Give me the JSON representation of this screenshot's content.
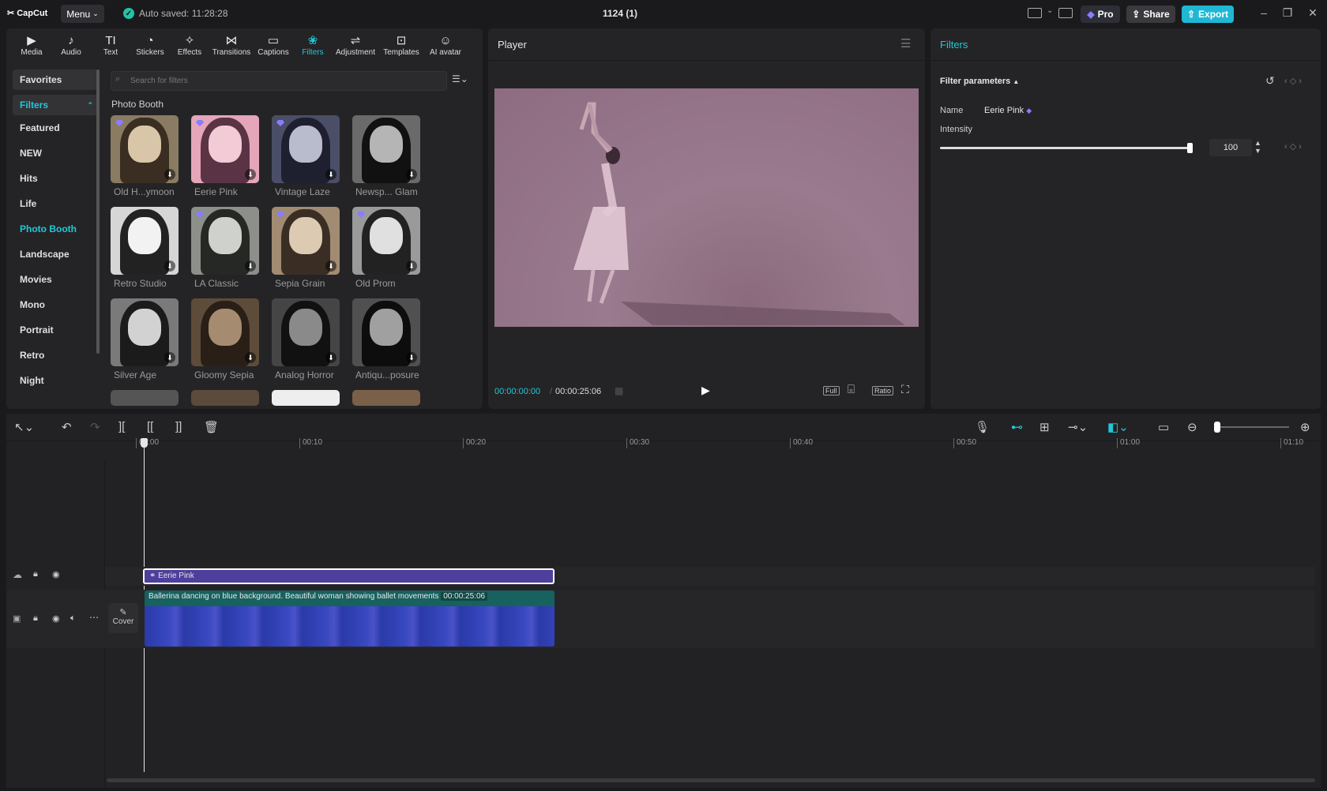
{
  "app": {
    "logo": "CapCut",
    "menu": "Menu",
    "autosave": "Auto saved: 11:28:28",
    "project_title": "1124 (1)",
    "pro": "Pro",
    "share": "Share",
    "export": "Export"
  },
  "tools": [
    {
      "label": "Media",
      "icon": "▶"
    },
    {
      "label": "Audio",
      "icon": "♪"
    },
    {
      "label": "Text",
      "icon": "TI"
    },
    {
      "label": "Stickers",
      "icon": "◔"
    },
    {
      "label": "Effects",
      "icon": "✧"
    },
    {
      "label": "Transitions",
      "icon": "⋈"
    },
    {
      "label": "Captions",
      "icon": "▭"
    },
    {
      "label": "Filters",
      "icon": "❀"
    },
    {
      "label": "Adjustment",
      "icon": "⇌"
    },
    {
      "label": "Templates",
      "icon": "⊡"
    },
    {
      "label": "AI avatar",
      "icon": "☺"
    }
  ],
  "sidebar": {
    "items": [
      "Favorites",
      "Filters",
      "Featured",
      "NEW",
      "Hits",
      "Life",
      "Photo Booth",
      "Landscape",
      "Movies",
      "Mono",
      "Portrait",
      "Retro",
      "Night"
    ],
    "selected": "Photo Booth"
  },
  "search": {
    "placeholder": "Search for filters"
  },
  "section_title": "Photo Booth",
  "filters": [
    {
      "label": "Old H...ymoon",
      "pro": true
    },
    {
      "label": "Eerie Pink",
      "pro": true
    },
    {
      "label": "Vintage Laze",
      "pro": true
    },
    {
      "label": "Newsp... Glam",
      "pro": false
    },
    {
      "label": "Retro Studio",
      "pro": false
    },
    {
      "label": "LA Classic",
      "pro": true
    },
    {
      "label": "Sepia Grain",
      "pro": true
    },
    {
      "label": "Old Prom",
      "pro": true
    },
    {
      "label": "Silver Age",
      "pro": false
    },
    {
      "label": "Gloomy Sepia",
      "pro": false
    },
    {
      "label": "Analog Horror",
      "pro": false
    },
    {
      "label": "Antiqu...posure",
      "pro": false
    }
  ],
  "player": {
    "title": "Player",
    "current_time": "00:00:00:00",
    "duration": "00:00:25:06",
    "full": "Full",
    "ratio": "Ratio"
  },
  "inspector": {
    "tab": "Filters",
    "section": "Filter parameters",
    "name_label": "Name",
    "name_value": "Eerie Pink",
    "intensity_label": "Intensity",
    "intensity_value": "100",
    "intensity_fraction": 1.0
  },
  "timeline": {
    "ruler": [
      "00:00",
      "00:10",
      "00:20",
      "00:30",
      "00:40",
      "00:50",
      "01:00",
      "01:10"
    ],
    "filter_clip": "Eerie Pink",
    "video_clip_title": "Ballerina dancing on blue background. Beautiful woman showing ballet movements",
    "video_clip_duration": "00:00:25:06",
    "cover_label": "Cover"
  },
  "colors": {
    "accent": "#1fc9d8",
    "export": "#1fb8d4",
    "filter_clip": "#4d3f9c",
    "video_clip": "#17615f"
  }
}
